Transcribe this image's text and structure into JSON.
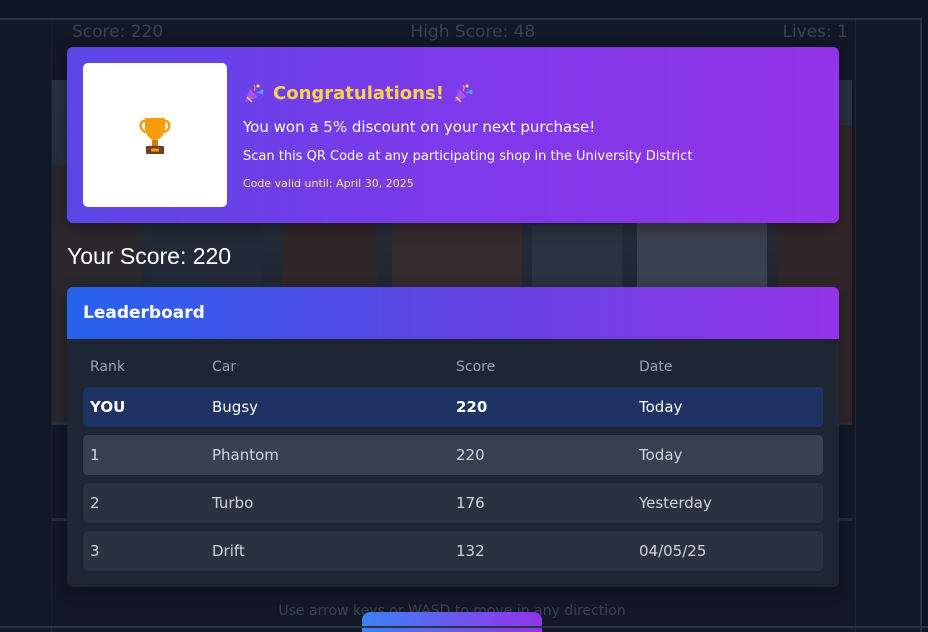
{
  "hud": {
    "score": "Score: 220",
    "high_score": "High Score: 48",
    "lives": "Lives: 1"
  },
  "congrats": {
    "title": "Congratulations!",
    "message": "You won a 5% discount on your next purchase!",
    "instruction": "Scan this QR Code at any participating shop in the University District",
    "valid_until": "Code valid until: April 30, 2025"
  },
  "your_score": "Your Score: 220",
  "leaderboard": {
    "title": "Leaderboard",
    "columns": [
      "Rank",
      "Car",
      "Score",
      "Date"
    ],
    "rows": [
      {
        "rank": "YOU",
        "car": "Bugsy",
        "score": "220",
        "date": "Today"
      },
      {
        "rank": "1",
        "car": "Phantom",
        "score": "220",
        "date": "Today"
      },
      {
        "rank": "2",
        "car": "Turbo",
        "score": "176",
        "date": "Yesterday"
      },
      {
        "rank": "3",
        "car": "Drift",
        "score": "132",
        "date": "04/05/25"
      }
    ]
  },
  "hint": "Use arrow keys or WASD to move in any direction",
  "colors": {
    "accent_blue": "#2563eb",
    "accent_purple": "#9333ea",
    "title_gold": "#fcd34d",
    "highlight_row": "#1e3363"
  }
}
